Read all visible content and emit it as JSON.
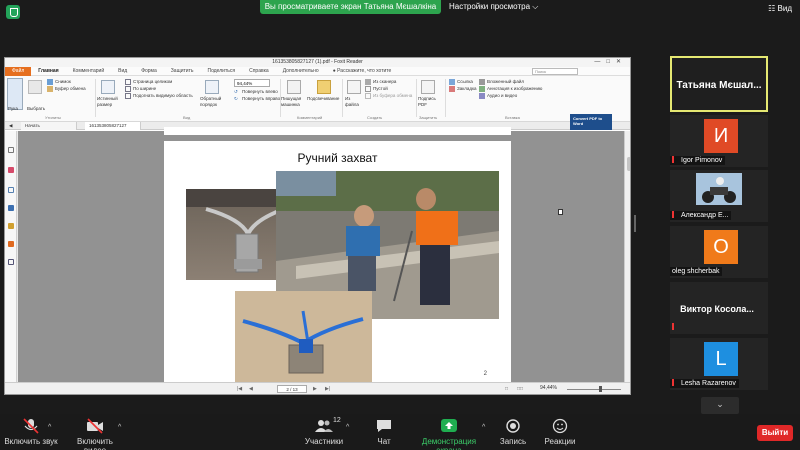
{
  "zoom": {
    "share_banner": "Вы просматриваете экран Татьяна Мєшалкіна",
    "view_options": "Настройки просмотра",
    "view_button": "Вид",
    "leave_button": "Выйти",
    "participants_count": "12",
    "toolbar": {
      "mute": "Включить звук",
      "video": "Включить видео",
      "participants": "Участники",
      "chat": "Чат",
      "share": "Демонстрация экрана",
      "record": "Запись",
      "reactions": "Реакции"
    }
  },
  "participants": [
    {
      "name": "Татьяна Мєшал...",
      "type": "name-only",
      "active": true
    },
    {
      "name": "Igor Pimonov",
      "type": "initial",
      "initial": "И",
      "color": "#e04a26",
      "muted": true
    },
    {
      "name": "Александр Е...",
      "type": "photo",
      "muted": true
    },
    {
      "name": "oleg shcherbak",
      "type": "initial",
      "initial": "O",
      "color": "#f07a1a",
      "muted": false
    },
    {
      "name": "Виктор Косола...",
      "type": "name-only",
      "muted": true
    },
    {
      "name": "Lesha Razarenov",
      "type": "initial",
      "initial": "L",
      "color": "#1e8fe0",
      "muted": true
    }
  ],
  "foxit": {
    "window_title": "161353805827127 (1).pdf - Foxit Reader",
    "menu": [
      "Файл",
      "Главная",
      "Комментарий",
      "Вид",
      "Форма",
      "Защитить",
      "Поделиться",
      "Справка",
      "Дополнительно"
    ],
    "search_hint": "Расскажите, что хотите",
    "search_field": "Поиск",
    "ribbon": {
      "hand": "Рука",
      "select": "Выбрать",
      "snapshot": "Снимок",
      "clipboard": "Буфер обмена",
      "actual_size": "Истинный размер",
      "fit_page": "Страница целиком",
      "fit_width": "По ширине",
      "fit_visible": "Подогнать видимую область",
      "reverse_order": "Обратный порядок",
      "zoom_value": "94,44%",
      "rotate_left": "Повернуть влево",
      "rotate_right": "Повернуть вправо",
      "typewriter": "Пишущая машинка",
      "highlight": "Подсвечивание",
      "from_file": "Из файла",
      "from_scanner": "Из сканера",
      "blank": "Пустой",
      "from_clipboard": "Из буфера обмена",
      "sign_pdf": "Подпись PDF",
      "link": "Ссылка",
      "bookmark": "Закладка",
      "attached_file": "Вложенный файл",
      "image_annotation": "Аннотация к изображению",
      "audio_video": "Аудио и видео",
      "group_tools": "Утилиты",
      "group_view": "Вид",
      "group_comment": "Комментарий",
      "group_create": "Создать",
      "group_protect": "Защитить",
      "group_insert": "Вставка"
    },
    "tabs": [
      "Начать",
      "161353805827127 (1)..."
    ],
    "convert_ad": "Convert PDF to Word",
    "page_title": "Ручний захват",
    "page_number": "2",
    "page_field": "2 / 13",
    "zoom_status": "94,44%"
  },
  "colors": {
    "banner_green": "#2da44e",
    "active_border": "#e5e872",
    "leave_red": "#e02828",
    "share_green": "#1fae50",
    "foxit_orange": "#e66f1f"
  }
}
